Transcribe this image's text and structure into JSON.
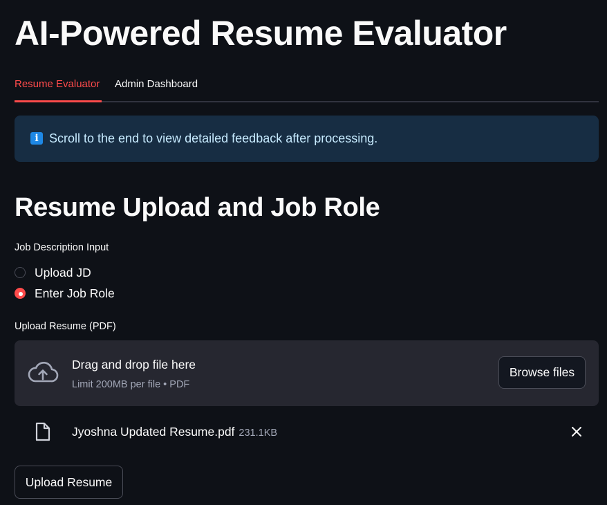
{
  "app": {
    "title": "AI-Powered Resume Evaluator"
  },
  "tabs": [
    {
      "label": "Resume Evaluator",
      "active": true
    },
    {
      "label": "Admin Dashboard",
      "active": false
    }
  ],
  "info": {
    "icon": "info-icon",
    "text": "Scroll to the end to view detailed feedback after processing."
  },
  "section": {
    "title": "Resume Upload and Job Role"
  },
  "jd_input": {
    "label": "Job Description Input",
    "options": [
      {
        "label": "Upload JD",
        "selected": false
      },
      {
        "label": "Enter Job Role",
        "selected": true
      }
    ]
  },
  "resume_upload": {
    "label": "Upload Resume (PDF)",
    "dropzone_title": "Drag and drop file here",
    "dropzone_subtitle": "Limit 200MB per file • PDF",
    "browse_label": "Browse files",
    "file": {
      "name": "Jyoshna Updated Resume.pdf",
      "size": "231.1KB"
    }
  },
  "actions": {
    "upload_label": "Upload Resume"
  },
  "colors": {
    "background": "#0e1117",
    "accent": "#ff4b4b",
    "info_bg": "#172d43",
    "info_text": "#c7ebff",
    "panel": "#262730"
  }
}
